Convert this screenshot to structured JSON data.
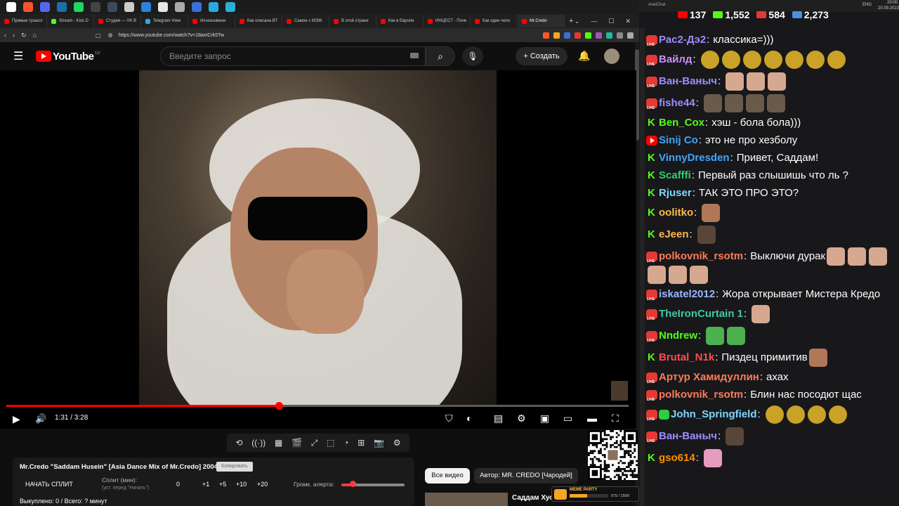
{
  "colors": {
    "accent": "#ff0000",
    "kick": "#53fc18",
    "chat_bg": "#18181b"
  },
  "taskbar": {
    "icons": [
      {
        "name": "windows-icon",
        "color": "#ffffff"
      },
      {
        "name": "brave-icon",
        "color": "#fb542b"
      },
      {
        "name": "discord-icon",
        "color": "#5865f2"
      },
      {
        "name": "steam-icon",
        "color": "#1b6fa8"
      },
      {
        "name": "spotify-icon",
        "color": "#1ed760"
      },
      {
        "name": "obs-icon",
        "color": "#444444"
      },
      {
        "name": "app-icon",
        "color": "#3c4a5c"
      },
      {
        "name": "xbox-icon",
        "color": "#cccccc"
      },
      {
        "name": "app-icon-2",
        "color": "#2a82da"
      },
      {
        "name": "app-icon-3",
        "color": "#e6e6e6"
      },
      {
        "name": "app-icon-4",
        "color": "#aaaaaa"
      },
      {
        "name": "app-icon-5",
        "color": "#3a6fd8"
      },
      {
        "name": "app-icon-6",
        "color": "#2aa8e0"
      },
      {
        "name": "app-icon-7",
        "color": "#2ab0d6"
      }
    ]
  },
  "browser": {
    "tabs": [
      {
        "label": "Прямые трансл",
        "color": "#ff0000"
      },
      {
        "label": "Stream - Kick D",
        "color": "#53fc18"
      },
      {
        "label": "Студия — VK В",
        "color": "#ff0000"
      },
      {
        "label": "Telegram View",
        "color": "#2aabee"
      },
      {
        "label": "Исчезновени",
        "color": "#ff0000"
      },
      {
        "label": "Как описана BT",
        "color": "#ff0000"
      },
      {
        "label": "Самое с МЭЖ",
        "color": "#ff0000"
      },
      {
        "label": "В этой стране",
        "color": "#ff0000"
      },
      {
        "label": "Как в Европе",
        "color": "#ff0000"
      },
      {
        "label": "ИНЦЕСТ - Поче",
        "color": "#ff0000"
      },
      {
        "label": "Как один чело",
        "color": "#ff0000"
      },
      {
        "label": "Mr.Credo",
        "color": "#ff0000",
        "active": true
      }
    ],
    "new_tab": "+",
    "window_controls": [
      "⌄",
      "—",
      "☐",
      "✕"
    ],
    "nav": [
      "‹",
      "›",
      "↻",
      "⌂"
    ],
    "url": "https://www.youtube.com/watch?v=18axICrk5Tw"
  },
  "youtube": {
    "logo_text": "YouTube",
    "country": "LV",
    "search_placeholder": "Введите запрос",
    "create_label": "+ Создать",
    "player": {
      "time": "1:31 / 3:28",
      "progress": 0.4375
    }
  },
  "widget": {
    "title": "Mr.Credo \"Saddam Husein\" [Asia Dance Mix of Mr.Credo] 2004",
    "copy_label": "Копировать",
    "start_split": "НАЧАТЬ СПЛИТ",
    "split_label": "Сплит (мин):",
    "split_hint": "(уст. перед \"Начать\")",
    "split_value": "0",
    "increments": [
      "+1",
      "+5",
      "+10",
      "+20"
    ],
    "alert_label": "Громк. алерта:",
    "alert_volume": 0.18,
    "bought": "Выкуплено: 0 / Всего: ? минут"
  },
  "chips": {
    "all_videos": "Все видео",
    "author": "Автор: MR. CREDO [Чародей]"
  },
  "recommendation": {
    "title": "Саддам Хус"
  },
  "meme_party": {
    "label": "MEME PARTY",
    "count": "675 / 1500",
    "progress": 0.45
  },
  "chat": {
    "app_name": "AxelChat",
    "system": {
      "lang": "ENG",
      "time": "20:00",
      "date": "20.09.2023"
    },
    "stats": [
      {
        "name": "youtube-viewers-icon",
        "color": "#ff0000",
        "value": "137"
      },
      {
        "name": "kick-viewers-icon",
        "color": "#53fc18",
        "value": "1,552"
      },
      {
        "name": "vk-viewers-icon",
        "color": "#e53935",
        "value": "584"
      },
      {
        "name": "total-viewers-icon",
        "color": "#4a90e2",
        "value": "2,273"
      }
    ],
    "messages": [
      {
        "platform": "live",
        "user": "Рас2-Дэ2",
        "color": "#9b8cff",
        "text": "классика=)))",
        "emotes": []
      },
      {
        "platform": "live",
        "user": "Вайлд",
        "color": "#c98cff",
        "text": "",
        "emotes": [
          "e-coin",
          "e-coin",
          "e-coin",
          "e-coin",
          "e-coin",
          "e-coin",
          "e-coin"
        ]
      },
      {
        "platform": "live",
        "user": "Ван-Ваныч",
        "color": "#9b8cff",
        "text": "",
        "emotes": [
          "e-hand",
          "e-hand",
          "e-hand"
        ]
      },
      {
        "platform": "live",
        "user": "fishe44",
        "color": "#9b8cff",
        "text": "",
        "emotes": [
          "e-man",
          "e-man",
          "e-man",
          "e-man"
        ]
      },
      {
        "platform": "kick",
        "user": "Ben_Cox",
        "color": "#53fc18",
        "text": "хэш - бола бола)))",
        "emotes": []
      },
      {
        "platform": "yt",
        "user": "Sinij Co",
        "color": "#3ea6ff",
        "text": "это не про хезболу",
        "emotes": []
      },
      {
        "platform": "kick",
        "user": "VinnyDresden",
        "color": "#3ea6ff",
        "text": "Привет, Саддам!",
        "emotes": []
      },
      {
        "platform": "kick",
        "user": "Scafffi",
        "color": "#2ecc71",
        "text": "Первый раз слышишь что ль ?",
        "emotes": []
      },
      {
        "platform": "kick",
        "user": "Rjuser",
        "color": "#7fd6ff",
        "text": "ТАК ЭТО ПРО ЭТО?",
        "emotes": []
      },
      {
        "platform": "kick",
        "user": "oolitko",
        "color": "#ffb84d",
        "text": "",
        "emotes": [
          "e-face"
        ]
      },
      {
        "platform": "kick",
        "user": "eJeen",
        "color": "#ffb84d",
        "text": "",
        "emotes": [
          "e-dark"
        ]
      },
      {
        "platform": "live",
        "user": "polkovnik_rsotm",
        "color": "#ff7a59",
        "text": "Выключи дурак",
        "emotes": [
          "e-hand",
          "e-hand",
          "e-hand",
          "e-hand",
          "e-hand",
          "e-hand"
        ]
      },
      {
        "platform": "live",
        "user": "iskatel2012",
        "color": "#9bb7ff",
        "text": "Жора открывает Мистера Кредо",
        "emotes": []
      },
      {
        "platform": "live",
        "user": "TheIronCurtain 1",
        "color": "#3ec9a7",
        "text": "",
        "emotes": [
          "e-hand"
        ]
      },
      {
        "platform": "live",
        "user": "Nndrew",
        "color": "#53fc18",
        "text": "",
        "emotes": [
          "e-frog",
          "e-frog"
        ]
      },
      {
        "platform": "kick",
        "user": "Brutal_N1k",
        "color": "#ff4d4d",
        "text": "Пиздец примитив",
        "emotes": [
          "e-face"
        ]
      },
      {
        "platform": "live",
        "user": "Артур Хамидуллин",
        "color": "#ff7a59",
        "text": "ахах",
        "emotes": []
      },
      {
        "platform": "live",
        "user": "polkovnik_rsotm",
        "color": "#ff7a59",
        "text": "Блин нас посодют щас",
        "emotes": []
      },
      {
        "platform": "live-check",
        "user": "John_Springfield",
        "color": "#7fd6ff",
        "text": "",
        "emotes": [
          "e-coin",
          "e-coin",
          "e-coin",
          "e-coin"
        ]
      },
      {
        "platform": "live",
        "user": "Ван-Ваныч",
        "color": "#9b8cff",
        "text": "",
        "emotes": [
          "e-dark"
        ]
      },
      {
        "platform": "kick",
        "user": "gso614",
        "color": "#ff8c00",
        "text": "",
        "emotes": [
          "e-pink"
        ]
      }
    ]
  }
}
